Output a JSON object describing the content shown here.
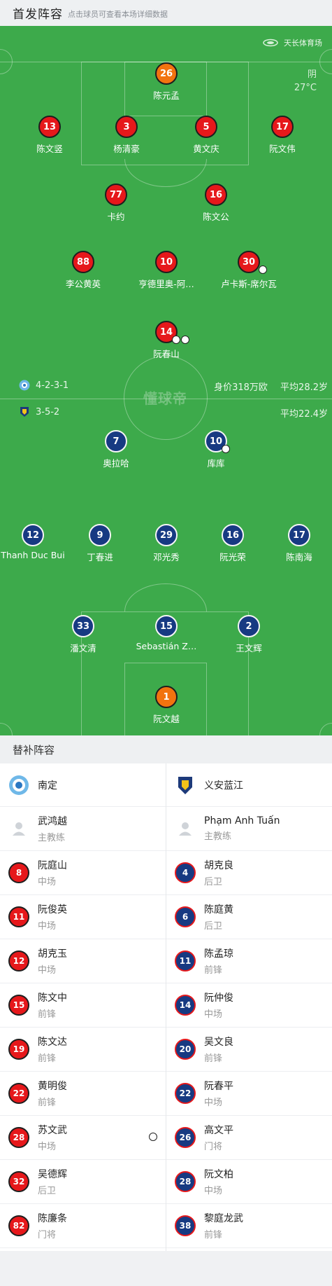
{
  "header": {
    "title": "首发阵容",
    "subtitle": "点击球员可查看本场详细数据"
  },
  "field": {
    "stadium": "天长体育场",
    "weather": {
      "condition": "阴",
      "temperature": "27°C"
    },
    "watermark": "懂球帝",
    "home": {
      "formation": "4-2-3-1",
      "value": "身价318万欧",
      "avg_age": "平均28.2岁"
    },
    "away": {
      "formation": "3-5-2",
      "avg_age": "平均22.4岁"
    }
  },
  "home_players": [
    {
      "num": "26",
      "name": "陈元孟",
      "style": "orange"
    },
    {
      "num": "13",
      "name": "陈文竖",
      "style": "red"
    },
    {
      "num": "3",
      "name": "杨清豪",
      "style": "red"
    },
    {
      "num": "5",
      "name": "黄文庆",
      "style": "red"
    },
    {
      "num": "17",
      "name": "阮文伟",
      "style": "red"
    },
    {
      "num": "77",
      "name": "卡约",
      "style": "red"
    },
    {
      "num": "16",
      "name": "陈文公",
      "style": "red"
    },
    {
      "num": "88",
      "name": "李公黄英",
      "style": "red"
    },
    {
      "num": "10",
      "name": "亨德里奥-阿…",
      "style": "red"
    },
    {
      "num": "30",
      "name": "卢卡斯-席尔瓦",
      "style": "red"
    },
    {
      "num": "14",
      "name": "阮春山",
      "style": "red"
    }
  ],
  "away_players": [
    {
      "num": "7",
      "name": "奥拉哈",
      "style": "blue"
    },
    {
      "num": "10",
      "name": "库库",
      "style": "blue"
    },
    {
      "num": "12",
      "name": "Thanh Duc Bui",
      "style": "blue"
    },
    {
      "num": "9",
      "name": "丁春进",
      "style": "blue"
    },
    {
      "num": "29",
      "name": "邓光秀",
      "style": "blue"
    },
    {
      "num": "16",
      "name": "阮光荣",
      "style": "blue"
    },
    {
      "num": "17",
      "name": "陈南海",
      "style": "blue"
    },
    {
      "num": "33",
      "name": "潘文清",
      "style": "blue"
    },
    {
      "num": "15",
      "name": "Sebastián Z…",
      "style": "blue"
    },
    {
      "num": "2",
      "name": "王文辉",
      "style": "blue"
    },
    {
      "num": "1",
      "name": "阮文越",
      "style": "orange"
    }
  ],
  "subs": {
    "title": "替补阵容",
    "home": {
      "team": "南定",
      "coach": {
        "name": "武鸿越",
        "role": "主教练"
      },
      "players": [
        {
          "num": "8",
          "name": "阮庭山",
          "pos": "中场"
        },
        {
          "num": "11",
          "name": "阮俊英",
          "pos": "中场"
        },
        {
          "num": "12",
          "name": "胡克玉",
          "pos": "中场"
        },
        {
          "num": "15",
          "name": "陈文中",
          "pos": "前锋"
        },
        {
          "num": "19",
          "name": "陈文达",
          "pos": "前锋"
        },
        {
          "num": "22",
          "name": "黄明俊",
          "pos": "前锋"
        },
        {
          "num": "28",
          "name": "苏文武",
          "pos": "中场"
        },
        {
          "num": "32",
          "name": "吴德辉",
          "pos": "后卫"
        },
        {
          "num": "82",
          "name": "陈廉条",
          "pos": "门将"
        }
      ]
    },
    "away": {
      "team": "义安蓝江",
      "coach": {
        "name": "Phạm Anh Tuấn",
        "role": "主教练"
      },
      "players": [
        {
          "num": "4",
          "name": "胡克良",
          "pos": "后卫"
        },
        {
          "num": "6",
          "name": "陈庭黄",
          "pos": "后卫"
        },
        {
          "num": "11",
          "name": "陈孟琼",
          "pos": "前锋"
        },
        {
          "num": "14",
          "name": "阮仲俊",
          "pos": "中场"
        },
        {
          "num": "20",
          "name": "吴文良",
          "pos": "前锋"
        },
        {
          "num": "22",
          "name": "阮春平",
          "pos": "中场"
        },
        {
          "num": "26",
          "name": "高文平",
          "pos": "门将"
        },
        {
          "num": "28",
          "name": "阮文柏",
          "pos": "中场"
        },
        {
          "num": "38",
          "name": "黎庭龙武",
          "pos": "前锋"
        }
      ]
    }
  },
  "colors": {
    "pitch": "#3daa4b",
    "home": "#e6181b",
    "away": "#173a82",
    "keeper": "#f2730f"
  }
}
